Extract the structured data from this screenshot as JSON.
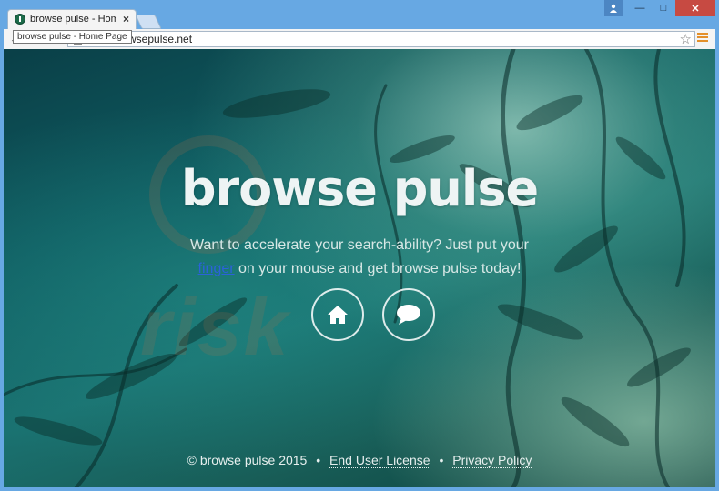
{
  "browser": {
    "tab_title": "browse pulse - Home Page",
    "tab_close": "×",
    "url": "www.browsepulse.net",
    "tooltip": "browse pulse - Home Page",
    "nav_back": "←",
    "nav_forward": "→",
    "nav_reload": "⟳",
    "star": "☆",
    "window_buttons": {
      "minimize": "—",
      "maximize": "□",
      "close": "✕",
      "user": "👤"
    }
  },
  "page": {
    "title": "browse pulse",
    "subtitle_line1": "Want to accelerate your search-ability? Just put your",
    "subtitle_link": "finger",
    "subtitle_line2_rest": "on your mouse and get browse pulse today!",
    "watermark": "risk",
    "footer": {
      "copyright": "© browse pulse 2015",
      "separator": "•",
      "eula": "End User License",
      "privacy": "Privacy Policy"
    }
  }
}
